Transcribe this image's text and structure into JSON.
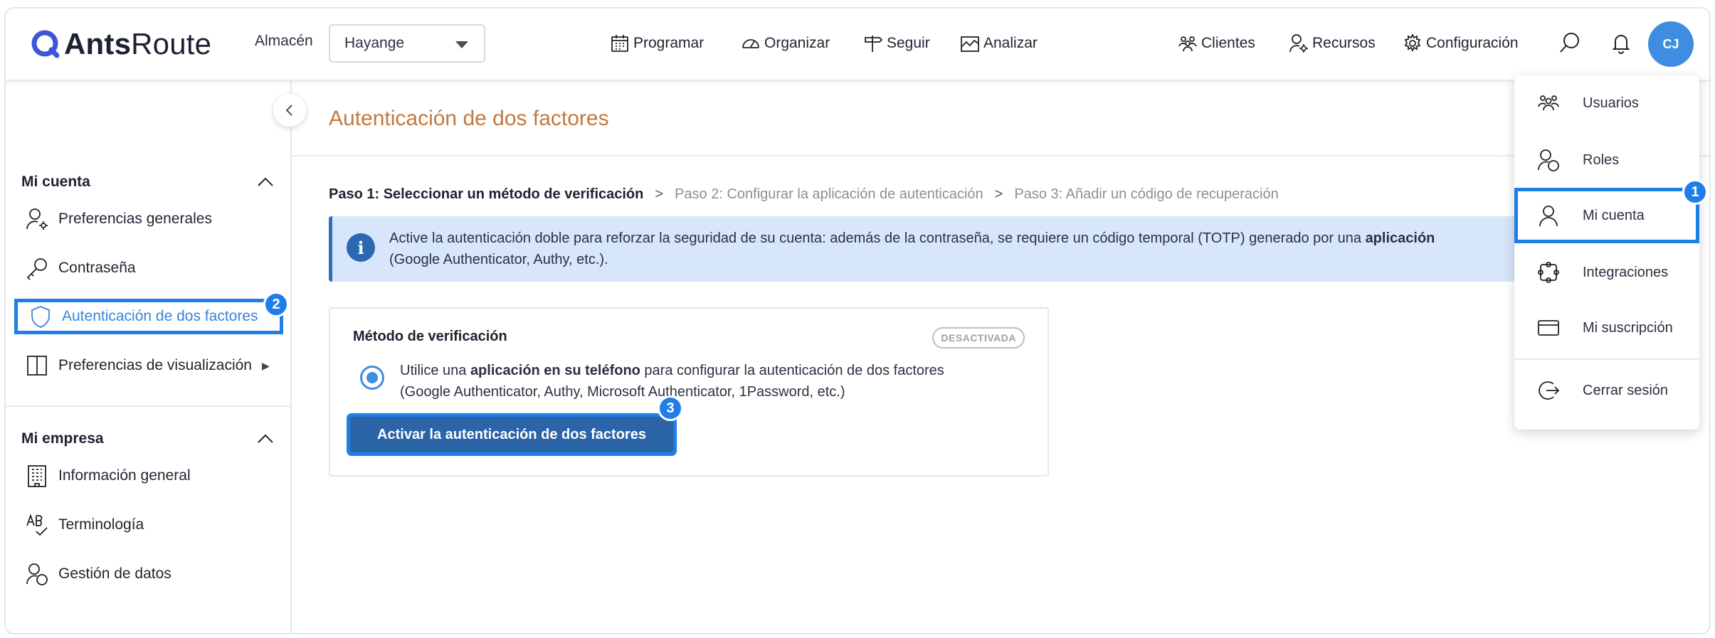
{
  "app": {
    "brand_bold": "Ants",
    "brand_light": "Route"
  },
  "header": {
    "store_label": "Almacén",
    "store_value": "Hayange",
    "nav": {
      "programar": "Programar",
      "organizar": "Organizar",
      "seguir": "Seguir",
      "analizar": "Analizar",
      "clientes": "Clientes",
      "recursos": "Recursos",
      "configuracion": "Configuración"
    },
    "avatar_initials": "CJ"
  },
  "sidebar": {
    "account_section": "Mi cuenta",
    "account_items": [
      {
        "label": "Preferencias generales",
        "icon": "user-gear-icon"
      },
      {
        "label": "Contraseña",
        "icon": "key-icon"
      },
      {
        "label": "Autenticación de dos factores",
        "icon": "shield-icon"
      },
      {
        "label": "Preferencias de visualización",
        "icon": "columns-icon",
        "arrow": "▶"
      }
    ],
    "company_section": "Mi empresa",
    "company_items": [
      {
        "label": "Información general",
        "icon": "building-icon"
      },
      {
        "label": "Terminología",
        "icon": "ab-check-icon"
      },
      {
        "label": "Gestión de datos",
        "icon": "user-data-icon"
      }
    ]
  },
  "main": {
    "title": "Autenticación de dos factores",
    "steps": {
      "step1": "Paso 1: Seleccionar un método de verificación",
      "sep": ">",
      "step2": "Paso 2: Configurar la aplicación de autenticación",
      "step3": "Paso 3: Añadir un código de recuperación"
    },
    "info": {
      "icon_glyph": "i",
      "text_before": "Active la autenticación doble para reforzar la seguridad de su cuenta: además de la contraseña, se requiere un código temporal (TOTP) generado por una ",
      "text_bold": "aplicación",
      "text_line2": "(Google Authenticator, Authy, etc.)."
    },
    "card": {
      "title": "Método de verificación",
      "status": "DESACTIVADA",
      "option_before": "Utilice una ",
      "option_bold": "aplicación en su teléfono",
      "option_after": " para configurar la autenticación de dos factores",
      "option_line2": "(Google Authenticator, Authy, Microsoft Authenticator, 1Password, etc.)",
      "button": "Activar la autenticación de dos factores"
    }
  },
  "dropdown": {
    "items": [
      {
        "label": "Usuarios",
        "icon": "users-icon"
      },
      {
        "label": "Roles",
        "icon": "roles-icon"
      },
      {
        "label": "Mi cuenta",
        "icon": "user-icon"
      },
      {
        "label": "Integraciones",
        "icon": "integrations-icon"
      },
      {
        "label": "Mi suscripción",
        "icon": "card-icon"
      }
    ],
    "logout": {
      "label": "Cerrar sesión",
      "icon": "logout-icon"
    }
  },
  "badges": {
    "one": "1",
    "two": "2",
    "three": "3"
  },
  "colors": {
    "accent": "#1f7ee8",
    "brand_blue": "#3f8de0",
    "title_orange": "#c3783f",
    "info_bg": "#d7e6fb",
    "button": "#2c64a8"
  }
}
